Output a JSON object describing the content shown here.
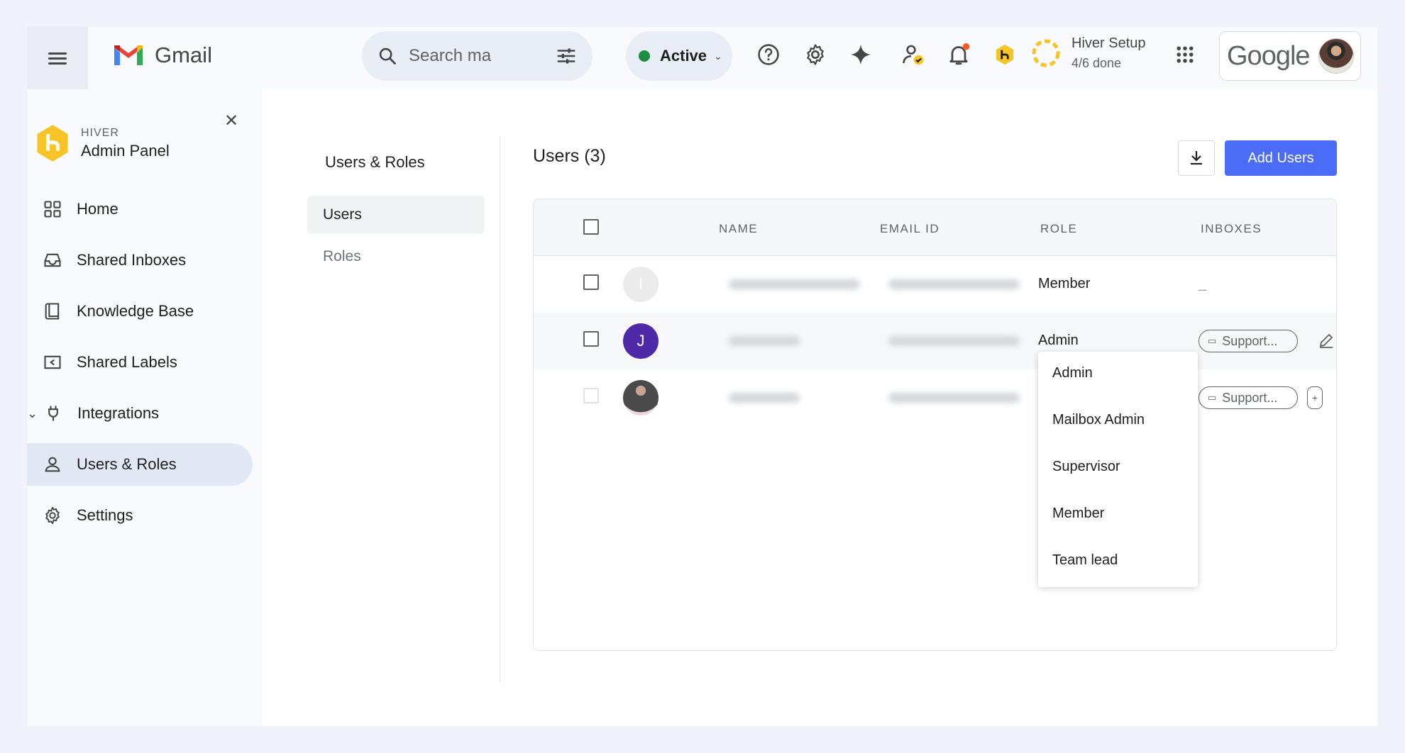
{
  "gmail": {
    "wordmark": "Gmail"
  },
  "search": {
    "placeholder": "Search ma"
  },
  "status": {
    "label": "Active",
    "color": "#1e8e3e"
  },
  "setup": {
    "title": "Hiver Setup",
    "progress": "4/6 done"
  },
  "google": {
    "wordmark": "Google"
  },
  "colors": {
    "accent": "#4a6cf7",
    "hiver_yellow": "#f7c325",
    "avatar_purple": "#4f2aa8",
    "notification_dot": "#ff5722"
  },
  "sidebar": {
    "brand_small": "HIVER",
    "brand_title": "Admin Panel",
    "items": [
      {
        "label": "Home",
        "icon": "grid-icon"
      },
      {
        "label": "Shared Inboxes",
        "icon": "inbox-icon"
      },
      {
        "label": "Knowledge Base",
        "icon": "book-icon"
      },
      {
        "label": "Shared Labels",
        "icon": "label-icon"
      },
      {
        "label": "Integrations",
        "icon": "plug-icon"
      },
      {
        "label": "Users & Roles",
        "icon": "person-icon",
        "active": true
      },
      {
        "label": "Settings",
        "icon": "gear-icon"
      }
    ]
  },
  "subnav": {
    "title": "Users & Roles",
    "items": [
      {
        "label": "Users",
        "active": true
      },
      {
        "label": "Roles"
      }
    ]
  },
  "users": {
    "title": "Users (3)",
    "add_button": "Add Users",
    "columns": [
      "NAME",
      "EMAIL ID",
      "ROLE",
      "INBOXES"
    ],
    "rows": [
      {
        "avatar_letter": "I",
        "role": "Member",
        "inboxes": "_"
      },
      {
        "avatar_letter": "J",
        "role": "Admin",
        "inboxes": "Support..."
      },
      {
        "avatar_letter": "",
        "role": "",
        "inboxes": "Support..."
      }
    ]
  },
  "role_dropdown": {
    "options": [
      "Admin",
      "Mailbox Admin",
      "Supervisor",
      "Member",
      "Team lead"
    ]
  }
}
